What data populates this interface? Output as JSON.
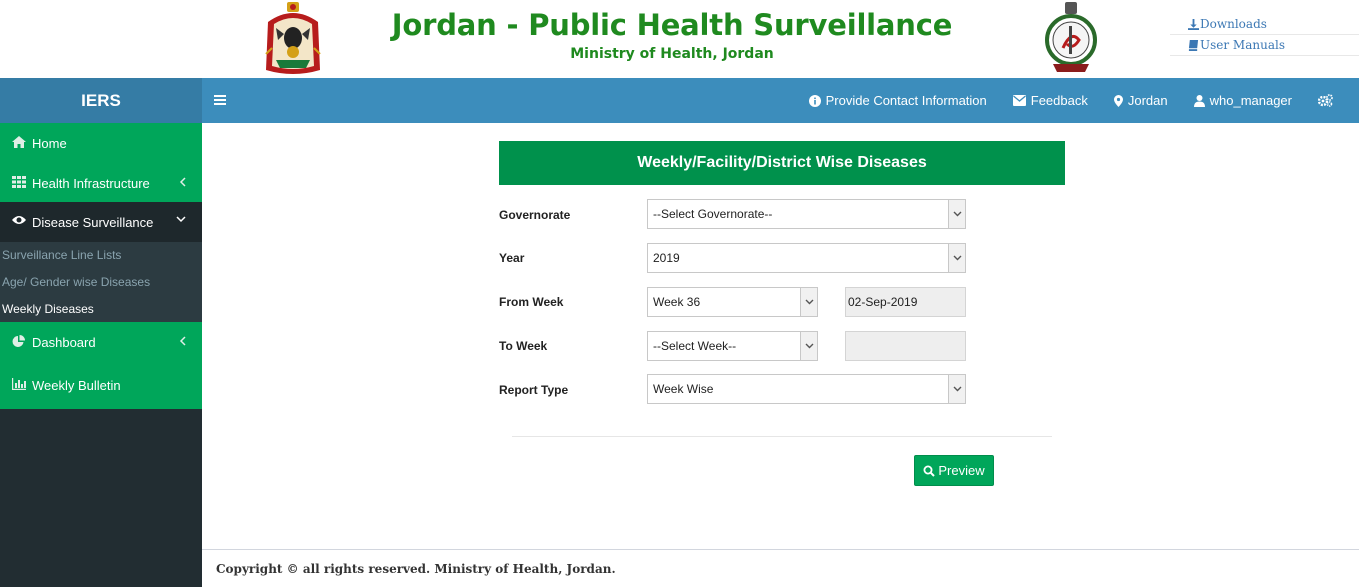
{
  "banner": {
    "title": "Jordan - Public Health Surveillance",
    "subtitle": "Ministry of Health, Jordan",
    "links": [
      {
        "label": "Downloads",
        "icon": "download-icon"
      },
      {
        "label": "User Manuals",
        "icon": "book-icon"
      }
    ]
  },
  "topbar": {
    "brand": "IERS",
    "items": [
      {
        "label": "Provide Contact Information",
        "icon": "info-icon"
      },
      {
        "label": "Feedback",
        "icon": "envelope-icon"
      },
      {
        "label": "Jordan",
        "icon": "map-marker-icon"
      },
      {
        "label": "who_manager",
        "icon": "user-icon"
      }
    ]
  },
  "sidebar": {
    "items": [
      {
        "label": "Home",
        "icon": "home-icon"
      },
      {
        "label": "Health Infrastructure",
        "icon": "grid-icon"
      },
      {
        "label": "Disease Surveillance",
        "icon": "eye-icon"
      },
      {
        "label": "Dashboard",
        "icon": "pie-chart-icon"
      },
      {
        "label": "Weekly Bulletin",
        "icon": "bar-chart-icon"
      }
    ],
    "submenu": [
      "Surveillance Line Lists",
      "Age/ Gender wise Diseases",
      "Weekly Diseases"
    ]
  },
  "form": {
    "title": "Weekly/Facility/District Wise Diseases",
    "governorate_label": "Governorate",
    "governorate_value": "--Select Governorate--",
    "year_label": "Year",
    "year_value": "2019",
    "from_week_label": "From Week",
    "from_week_value": "Week 36",
    "from_week_date": "02-Sep-2019",
    "to_week_label": "To Week",
    "to_week_value": "--Select Week--",
    "to_week_date": "",
    "report_type_label": "Report Type",
    "report_type_value": "Week Wise",
    "preview_label": "Preview"
  },
  "footer": {
    "text": "Copyright © all rights reserved. Ministry of Health, Jordan."
  },
  "colors": {
    "brand_green": "#1f8a1f",
    "sidebar_green": "#00a65a",
    "topbar_blue": "#3c8dbc",
    "sidebar_dark": "#222d32"
  }
}
